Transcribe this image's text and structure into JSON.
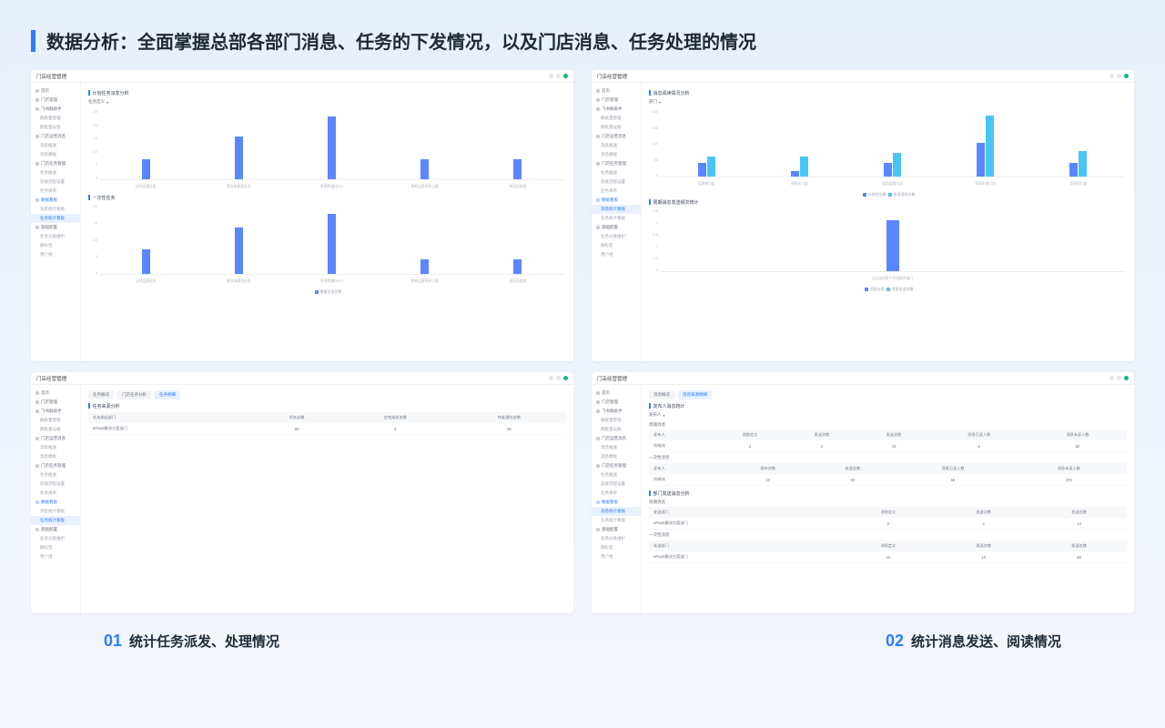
{
  "header": "数据分析：全面掌握总部各部门消息、任务的下发情况，以及门店消息、任务处理的情况",
  "appTitle": "门店经营管理",
  "nav": {
    "home": "首页",
    "store": "门店管理",
    "feishu": "飞书群助手",
    "groupBatch": "群批量管理",
    "groupSet": "群批量设备",
    "msg": "门店运营消息",
    "msgPush": "消息推送",
    "msgTpl": "消息模板",
    "task": "门店任务管理",
    "taskPush": "任务推送",
    "taskFlow": "验收流程设置",
    "taskList": "任务清单",
    "board": "数据看板",
    "msgBoard": "消息统计看板",
    "taskBoard": "任务统计看板",
    "base": "基础配置",
    "taskCat": "任务分类维护",
    "groupLbl": "群标签",
    "userGrp": "用户组"
  },
  "c1": {
    "sec1": "计划任务派发分析",
    "drop": "任务定义",
    "sec2": "一次性任务",
    "leg": "需要任务总数"
  },
  "c2": {
    "sec1": "消息阅读情况分析",
    "drop": "部门",
    "sec2": "周期消息发送频次统计",
    "leg1": "计划任务数",
    "leg2": "未读消息总数",
    "leg3": "消息分类",
    "leg4": "消息发送次数",
    "xl2": "当日运转是个外组联合部门"
  },
  "c3": {
    "tabs": [
      "任务概况",
      "门店任务分析",
      "任务明细"
    ],
    "sec": "任务来源分析",
    "th": [
      "任务发起部门",
      "任务总数",
      "应完成任务数",
      "待处理任务数"
    ],
    "row": [
      "aPaaS解决方案部门",
      "59",
      "4",
      "55"
    ]
  },
  "c4": {
    "tabs": [
      "消息概况",
      "消息来源明细"
    ],
    "sec1": "发布人消息统计",
    "drop": "发布人",
    "sec2": "周期消息",
    "th1": [
      "发布人",
      "消息定义",
      "发送次数",
      "发送总数",
      "消息已读人数",
      "消息未读人数"
    ],
    "r1": [
      "刘晓玮",
      "2",
      "2",
      "13",
      "6",
      "82"
    ],
    "sec3": "一次性消息",
    "th2": [
      "发布人",
      "发布次数",
      "发送总数",
      "消息已读人数",
      "消息未读人数"
    ],
    "r2": [
      "刘晓玮",
      "10",
      "60",
      "68",
      "370"
    ],
    "sec4": "部门发送消息分析",
    "sec5": "周期消息",
    "th3": [
      "发送部门",
      "消息定义",
      "发送次数",
      "发送总数"
    ],
    "r3": [
      "aPaaS解决方案部门",
      "2",
      "2",
      "13"
    ],
    "sec6": "一次性消息",
    "th4": [
      "发送部门",
      "消息定义",
      "发送次数",
      "发送总数"
    ],
    "r4": [
      "aPaaS解决方案部门",
      "10",
      "10",
      "60"
    ]
  },
  "chart_data": [
    {
      "type": "bar",
      "title": "计划任务派发分析",
      "ylim": [
        0,
        25
      ],
      "categories": [
        "日时运营任务",
        "营业每晨签任务",
        "罗家辉通任017",
        "常新运营时间上报",
        "排班员报表"
      ],
      "values": [
        7,
        15,
        22,
        7,
        7
      ]
    },
    {
      "type": "bar",
      "title": "一次性任务",
      "ylim": [
        0,
        20
      ],
      "categories": [
        "日时运营任务",
        "营业每晨签任务",
        "罗家辉通任017",
        "常新运营时间上报",
        "排班员报表"
      ],
      "values": [
        7,
        13,
        17,
        4,
        4
      ]
    },
    {
      "type": "bar",
      "title": "消息阅读情况分析",
      "ylim": [
        0,
        200
      ],
      "categories": [
        "深圳南门店",
        "深圳东门店",
        "深圳监管门店",
        "深圳东南门店",
        "深圳西门店"
      ],
      "series": [
        {
          "name": "计划任务数",
          "values": [
            40,
            15,
            40,
            100,
            40
          ]
        },
        {
          "name": "未读消息总数",
          "values": [
            60,
            60,
            70,
            180,
            75
          ]
        }
      ]
    },
    {
      "type": "bar",
      "title": "周期消息发送频次统计",
      "ylim": [
        0,
        2.5
      ],
      "categories": [
        "当日运转是个外组联合部门"
      ],
      "values": [
        2
      ]
    }
  ],
  "foot": {
    "n1": "01",
    "t1": "统计任务派发、处理情况",
    "n2": "02",
    "t2": "统计消息发送、阅读情况"
  }
}
